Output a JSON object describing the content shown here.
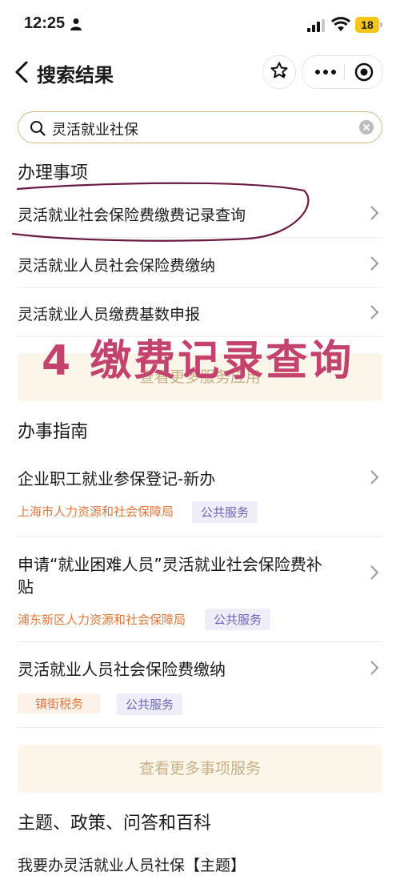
{
  "status_bar": {
    "time": "12:25",
    "battery": "18"
  },
  "nav": {
    "title": "搜索结果"
  },
  "search": {
    "value": "灵活就业社保"
  },
  "section_tasks": {
    "title": "办理事项",
    "items": [
      {
        "label": "灵活就业社会保险费缴费记录查询"
      },
      {
        "label": "灵活就业人员社会保险费缴纳"
      },
      {
        "label": "灵活就业人员缴费基数申报"
      }
    ],
    "more_label": "查看更多服务应用"
  },
  "annotation": {
    "text": "4 缴费记录查询",
    "color": "#c4426e"
  },
  "section_guide": {
    "title": "办事指南",
    "items": [
      {
        "title": "企业职工就业参保登记-新办",
        "dept": "上海市人力资源和社会保障局",
        "tag": "公共服务"
      },
      {
        "title_line1": "申请“就业困难人员”灵活就业社会保险费补",
        "title_line2": "贴",
        "dept": "浦东新区人力资源和社会保障局",
        "tag": "公共服务"
      },
      {
        "title": "灵活就业人员社会保险费缴纳",
        "dept": "镇街税务",
        "tag": "公共服务"
      }
    ],
    "more_label": "查看更多事项服务"
  },
  "section_topics": {
    "title": "主题、政策、问答和百科",
    "first_item": "我要办灵活就业人员社保【主题】"
  },
  "colors": {
    "accent_border": "#d3b98a",
    "dept_orange": "#e0783e",
    "public_purple": "#6c66b8",
    "more_bg": "#fbf5ea"
  }
}
